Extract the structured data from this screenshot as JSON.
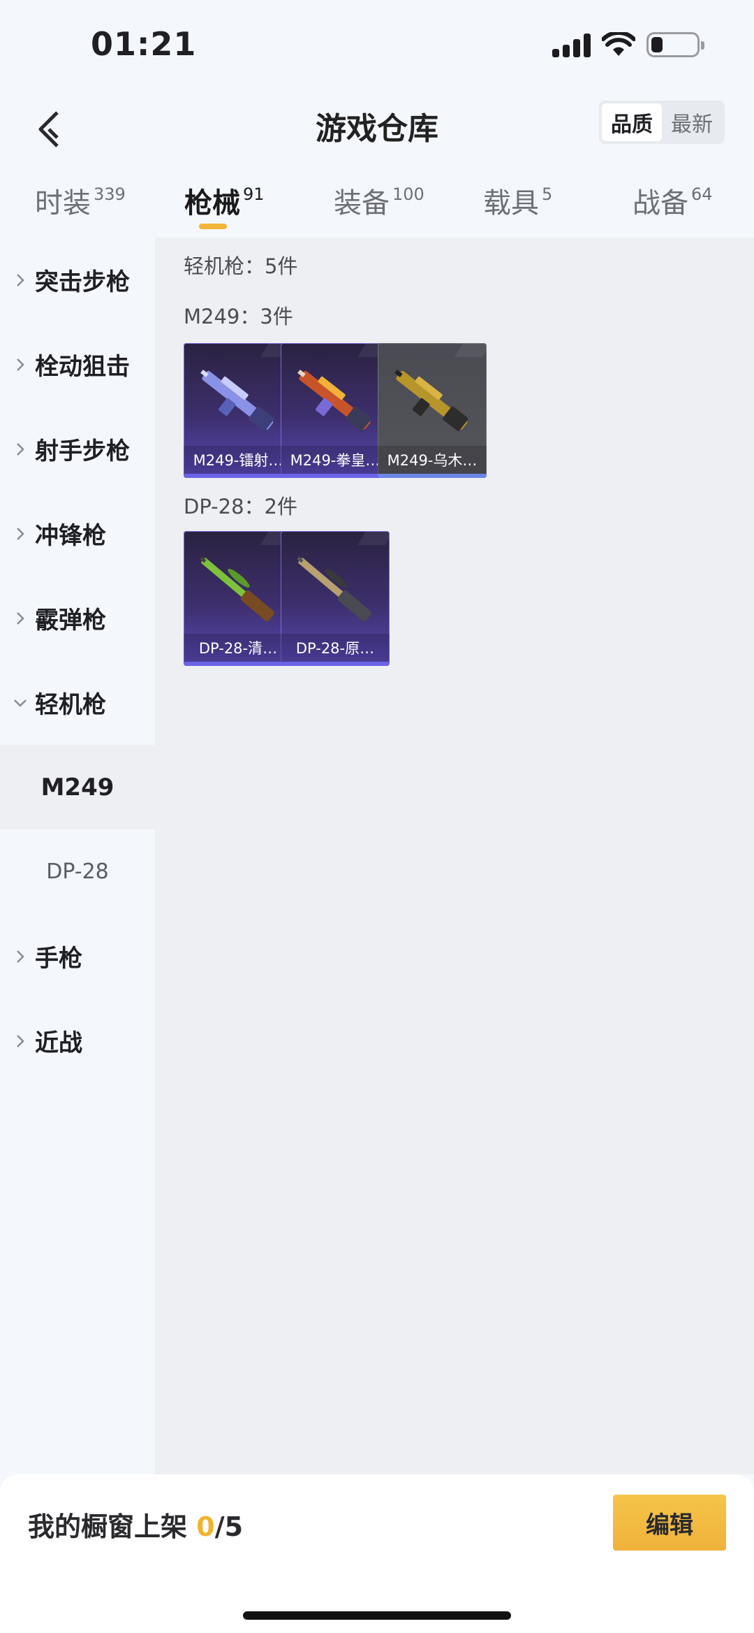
{
  "status_bar": {
    "time": "01:21",
    "battery_level": 0.25
  },
  "header": {
    "title": "游戏仓库",
    "sort_options": [
      "品质",
      "最新"
    ],
    "active_sort": "品质"
  },
  "tabs": [
    {
      "label": "时装",
      "count": "339"
    },
    {
      "label": "枪械",
      "count": "91"
    },
    {
      "label": "装备",
      "count": "100"
    },
    {
      "label": "载具",
      "count": "5"
    },
    {
      "label": "战备",
      "count": "64"
    }
  ],
  "active_tab": "枪械",
  "sidebar": {
    "items": [
      {
        "label": "突击步枪"
      },
      {
        "label": "栓动狙击"
      },
      {
        "label": "射手步枪"
      },
      {
        "label": "冲锋枪"
      },
      {
        "label": "霰弹枪"
      },
      {
        "label": "轻机枪"
      },
      {
        "label": "手枪"
      },
      {
        "label": "近战"
      }
    ],
    "sub_items": [
      {
        "label": "M249"
      },
      {
        "label": "DP-28"
      }
    ]
  },
  "main": {
    "category_summary": "轻机枪：5件",
    "groups": [
      {
        "title": "M249：3件",
        "items": [
          {
            "name": "M249-镭射…",
            "rarity": "purple"
          },
          {
            "name": "M249-拳皇…",
            "rarity": "purple"
          },
          {
            "name": "M249-乌木…",
            "rarity": "gray"
          }
        ]
      },
      {
        "title": "DP-28：2件",
        "items": [
          {
            "name": "DP-28-清…",
            "rarity": "purple"
          },
          {
            "name": "DP-28-原…",
            "rarity": "purple"
          }
        ]
      }
    ]
  },
  "bottom": {
    "label": "我的橱窗上架",
    "current": "0",
    "max": "/5",
    "edit_label": "编辑"
  },
  "colors": {
    "accent": "#f3b43a",
    "purple": "#5a49b8",
    "gray": "#55555c"
  }
}
